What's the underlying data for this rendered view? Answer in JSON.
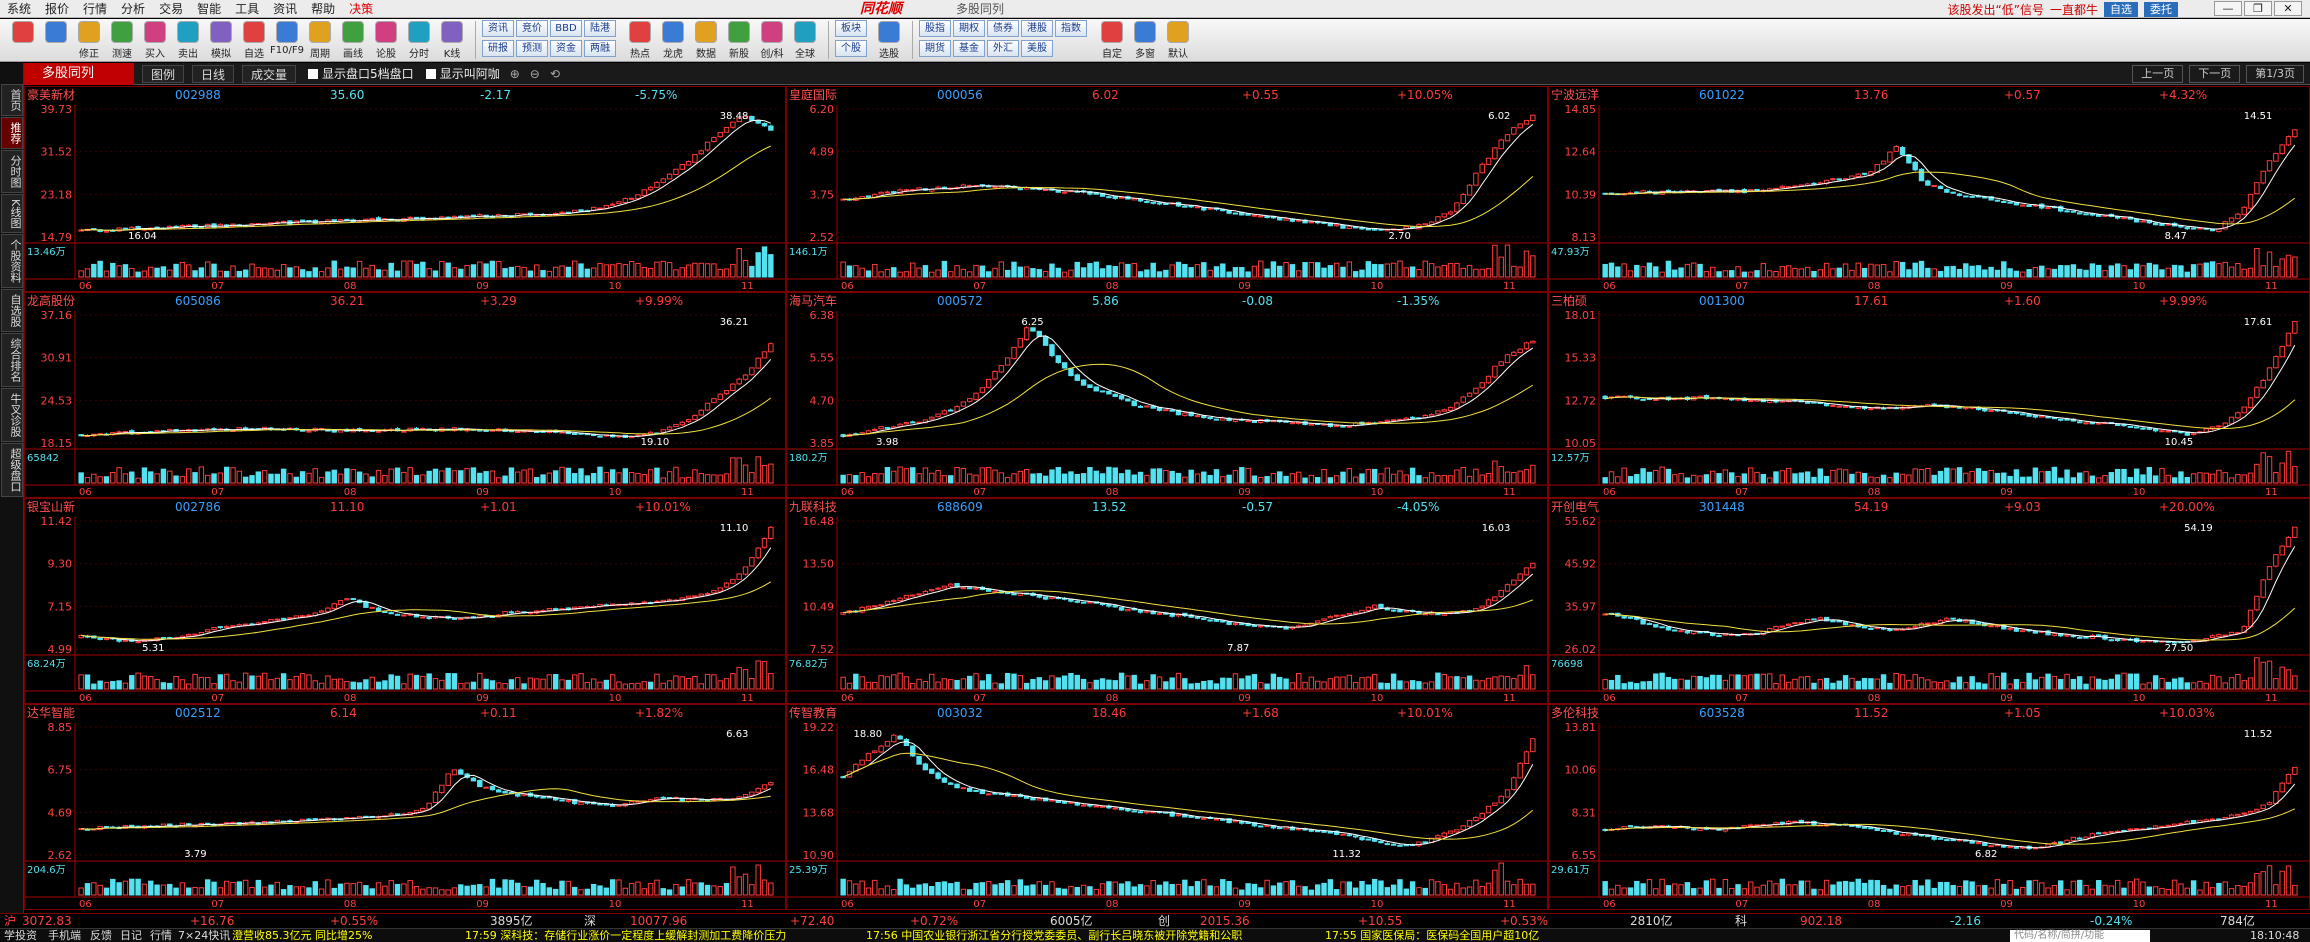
{
  "menu": {
    "items": [
      "系统",
      "报价",
      "行情",
      "分析",
      "交易",
      "智能",
      "工具",
      "资讯",
      "帮助",
      "决策"
    ],
    "logo": "同花顺",
    "window_title": "多股同列",
    "right_hint": "该股发出“低”信号",
    "right_hint2": "一直都牛",
    "btn_login": "自选",
    "btn_trade": "委托",
    "win_controls": [
      "—",
      "❐",
      "✕"
    ]
  },
  "toolbar": {
    "buttons": [
      {
        "label": "",
        "icon": "window-icon"
      },
      {
        "label": "",
        "icon": "back-icon"
      },
      {
        "label": "修正",
        "icon": "face-icon"
      },
      {
        "label": "测速",
        "icon": "clock-icon"
      },
      {
        "label": "买入",
        "icon": "buy-icon"
      },
      {
        "label": "卖出",
        "icon": "sell-icon"
      },
      {
        "label": "模拟",
        "icon": "hammer-icon"
      },
      {
        "label": "自选",
        "icon": "star-list-icon"
      },
      {
        "label": "F10/F9",
        "icon": "f10-icon"
      },
      {
        "label": "周期",
        "icon": "cycle-icon"
      },
      {
        "label": "画线",
        "icon": "pen-icon"
      },
      {
        "label": "论股",
        "icon": "discuss-icon"
      },
      {
        "label": "分时",
        "icon": "timeline-icon"
      },
      {
        "label": "K线",
        "icon": "kline-icon"
      }
    ],
    "grid_buttons": [
      "资讯",
      "竞价",
      "BBD",
      "陆港",
      "研报",
      "预测",
      "资金",
      "两融"
    ],
    "buttons2": [
      {
        "label": "热点",
        "icon": "fire-icon"
      },
      {
        "label": "龙虎",
        "icon": "dragon-icon"
      },
      {
        "label": "数据",
        "icon": "data-icon"
      },
      {
        "label": "新股",
        "icon": "newstock-icon"
      },
      {
        "label": "创/科",
        "icon": "innov-icon"
      },
      {
        "label": "全球",
        "icon": "globe-icon"
      }
    ],
    "grid_buttons2": [
      "板块",
      "个股"
    ],
    "select_label": "选股",
    "grid_buttons3": [
      "股指",
      "期权",
      "债券",
      "港股",
      "指数",
      "期货",
      "基金",
      "外汇",
      "美股"
    ],
    "buttons3": [
      {
        "label": "自定",
        "icon": "custom-icon"
      },
      {
        "label": "多窗",
        "icon": "multiwin-icon"
      },
      {
        "label": "默认",
        "icon": "home-icon"
      }
    ]
  },
  "subbar": {
    "title": "多股同列",
    "layout": "图例",
    "period": "日线",
    "indicator": "成交量",
    "opt1": "显示盘口5档盘口",
    "opt2": "显示叫阿咖",
    "prev": "上一页",
    "next": "下一页",
    "page": "第1/3页"
  },
  "sidetabs": [
    "首页",
    "推荐",
    "分时图",
    "K线图",
    "个股资料",
    "自选股",
    "综合排名",
    "牛叉诊股",
    "超级盘口"
  ],
  "theme": {
    "up": "#ff3a3a",
    "down": "#54e1f0",
    "name": "#ff5050",
    "code": "#3aa0ff",
    "axis": "#aa0000",
    "ma1": "#ffffff",
    "ma2": "#f0e040"
  },
  "panes": [
    {
      "name": "豪美新材",
      "code": "002988",
      "price": "35.60",
      "change": "-2.17",
      "pct": "-5.75%",
      "dir": "down",
      "yticks": [
        "39.73",
        "31.52",
        "23.18",
        "14.79"
      ],
      "ylo": 14.79,
      "yhi": 39.73,
      "vol": "13.46万",
      "xlabels": [
        "06",
        "07",
        "08",
        "09",
        "10",
        "11"
      ],
      "hi_label": "38.48",
      "lo_label": "16.04",
      "hi_at": 0.965,
      "lo_at": 0.07,
      "series": [
        16.0,
        16.2,
        16.4,
        16.6,
        16.8,
        17.0,
        17.2,
        17.4,
        17.6,
        17.8,
        18.0,
        18.1,
        18.3,
        18.5,
        18.7,
        18.9,
        19.0,
        19.2,
        19.5,
        20,
        21,
        23,
        26,
        30,
        35,
        38.48,
        35.6
      ]
    },
    {
      "name": "皇庭国际",
      "code": "000056",
      "price": "6.02",
      "change": "+0.55",
      "pct": "+10.05%",
      "dir": "up",
      "yticks": [
        "6.20",
        "4.89",
        "3.75",
        "2.52"
      ],
      "ylo": 2.52,
      "yhi": 6.2,
      "vol": "146.1万",
      "xlabels": [
        "06",
        "07",
        "08",
        "09",
        "10",
        "11"
      ],
      "hi_label": "6.02",
      "lo_label": "2.70",
      "hi_at": 0.965,
      "lo_at": 0.78,
      "series": [
        3.6,
        3.7,
        3.85,
        3.9,
        3.95,
        4.0,
        3.95,
        3.9,
        3.85,
        3.8,
        3.7,
        3.6,
        3.5,
        3.4,
        3.3,
        3.2,
        3.1,
        3.0,
        2.9,
        2.8,
        2.7,
        2.75,
        2.9,
        3.3,
        4.5,
        5.47,
        6.02
      ]
    },
    {
      "name": "宁波远洋",
      "code": "601022",
      "price": "13.76",
      "change": "+0.57",
      "pct": "+4.32%",
      "dir": "up",
      "yticks": [
        "14.85",
        "12.64",
        "10.39",
        "8.13"
      ],
      "ylo": 8.13,
      "yhi": 14.85,
      "vol": "47.93万",
      "xlabels": [
        "06",
        "07",
        "08",
        "09",
        "10",
        "11"
      ],
      "hi_label": "14.51",
      "lo_label": "8.47",
      "hi_at": 0.965,
      "lo_at": 0.8,
      "series": [
        10.4,
        10.5,
        10.45,
        10.5,
        10.6,
        10.5,
        10.6,
        10.8,
        11.0,
        11.2,
        11.5,
        12.9,
        11.0,
        10.4,
        10.2,
        10.0,
        9.8,
        9.6,
        9.4,
        9.2,
        9.0,
        8.8,
        8.6,
        8.5,
        9.5,
        12.0,
        13.76
      ]
    },
    {
      "name": "龙高股份",
      "code": "605086",
      "price": "36.21",
      "change": "+3.29",
      "pct": "+9.99%",
      "dir": "up",
      "yticks": [
        "37.16",
        "30.91",
        "24.53",
        "18.15"
      ],
      "ylo": 18.15,
      "yhi": 37.16,
      "vol": "65842",
      "xlabels": [
        "06",
        "07",
        "08",
        "09",
        "10",
        "11"
      ],
      "hi_label": "36.21",
      "lo_label": "19.10",
      "hi_at": 0.965,
      "lo_at": 0.8,
      "series": [
        19.3,
        19.5,
        19.7,
        19.9,
        20.0,
        20.1,
        20.2,
        20.3,
        20.2,
        20.1,
        20.0,
        20.0,
        20.1,
        20.2,
        20.2,
        20.1,
        20.0,
        19.9,
        19.8,
        19.5,
        19.2,
        19.1,
        20,
        22,
        25,
        28,
        32.9
      ]
    },
    {
      "name": "海马汽车",
      "code": "000572",
      "price": "5.86",
      "change": "-0.08",
      "pct": "-1.35%",
      "dir": "down",
      "yticks": [
        "6.38",
        "5.55",
        "4.70",
        "3.85"
      ],
      "ylo": 3.85,
      "yhi": 6.38,
      "vol": "180.2万",
      "xlabels": [
        "06",
        "07",
        "08",
        "09",
        "10",
        "11"
      ],
      "hi_label": "6.25",
      "lo_label": "3.98",
      "hi_at": 0.3,
      "lo_at": 0.05,
      "series": [
        4.0,
        4.1,
        4.2,
        4.3,
        4.5,
        4.8,
        5.4,
        6.2,
        5.5,
        5.0,
        4.8,
        4.6,
        4.5,
        4.4,
        4.35,
        4.3,
        4.3,
        4.25,
        4.2,
        4.2,
        4.25,
        4.3,
        4.4,
        4.6,
        5.0,
        5.6,
        5.86
      ]
    },
    {
      "name": "三柏硕",
      "code": "001300",
      "price": "17.61",
      "change": "+1.60",
      "pct": "+9.99%",
      "dir": "up",
      "yticks": [
        "18.01",
        "15.33",
        "12.72",
        "10.05"
      ],
      "ylo": 10.05,
      "yhi": 18.01,
      "vol": "12.57万",
      "xlabels": [
        "06",
        "07",
        "08",
        "09",
        "10",
        "11"
      ],
      "hi_label": "17.61",
      "lo_label": "10.45",
      "hi_at": 0.965,
      "lo_at": 0.8,
      "series": [
        12.9,
        12.9,
        12.8,
        12.85,
        12.9,
        12.8,
        12.7,
        12.6,
        12.5,
        12.4,
        12.2,
        12.3,
        12.4,
        12.3,
        12.2,
        12.0,
        11.8,
        11.6,
        11.4,
        11.2,
        11.0,
        10.8,
        10.6,
        11.0,
        12.0,
        14.5,
        17.61
      ]
    },
    {
      "name": "银宝山新",
      "code": "002786",
      "price": "11.10",
      "change": "+1.01",
      "pct": "+10.01%",
      "dir": "up",
      "yticks": [
        "11.42",
        "9.30",
        "7.15",
        "4.99"
      ],
      "ylo": 4.99,
      "yhi": 11.42,
      "vol": "68.24万",
      "xlabels": [
        "06",
        "07",
        "08",
        "09",
        "10",
        "11"
      ],
      "hi_label": "11.10",
      "lo_label": "5.31",
      "hi_at": 0.965,
      "lo_at": 0.09,
      "series": [
        5.6,
        5.5,
        5.4,
        5.5,
        5.7,
        6.0,
        6.2,
        6.4,
        6.6,
        6.8,
        7.6,
        7.0,
        6.7,
        6.6,
        6.5,
        6.6,
        6.8,
        6.9,
        7.0,
        7.1,
        7.2,
        7.3,
        7.4,
        7.6,
        8.0,
        9.0,
        11.1
      ]
    },
    {
      "name": "九联科技",
      "code": "688609",
      "price": "13.52",
      "change": "-0.57",
      "pct": "-4.05%",
      "dir": "down",
      "yticks": [
        "16.48",
        "13.50",
        "10.49",
        "7.52"
      ],
      "ylo": 7.52,
      "yhi": 16.48,
      "vol": "76.82万",
      "xlabels": [
        "06",
        "07",
        "08",
        "09",
        "10",
        "11"
      ],
      "hi_label": "16.03",
      "lo_label": "7.87",
      "hi_at": 0.965,
      "lo_at": 0.55,
      "series": [
        10.0,
        10.5,
        11.0,
        11.5,
        12.0,
        11.8,
        11.5,
        11.3,
        11.0,
        10.8,
        10.5,
        10.2,
        10.0,
        9.8,
        9.5,
        9.2,
        9.0,
        9.0,
        9.5,
        10.0,
        10.5,
        10.2,
        10.0,
        10.0,
        10.3,
        12.0,
        13.52
      ]
    },
    {
      "name": "开创电气",
      "code": "301448",
      "price": "54.19",
      "change": "+9.03",
      "pct": "+20.00%",
      "dir": "up",
      "yticks": [
        "55.62",
        "45.92",
        "35.97",
        "26.02"
      ],
      "ylo": 26.02,
      "yhi": 55.62,
      "vol": "76698",
      "xlabels": [
        "06",
        "07",
        "08",
        "09",
        "10",
        "11"
      ],
      "hi_label": "54.19",
      "lo_label": "27.50",
      "hi_at": 0.88,
      "lo_at": 0.8,
      "series": [
        34,
        33,
        31,
        30,
        29.5,
        29,
        30,
        32,
        33,
        32,
        31,
        30.5,
        32,
        33,
        32,
        31,
        30,
        29.5,
        29,
        28.5,
        28,
        27.5,
        28,
        29,
        30,
        45,
        54.19
      ]
    },
    {
      "name": "达华智能",
      "code": "002512",
      "price": "6.14",
      "change": "+0.11",
      "pct": "+1.82%",
      "dir": "up",
      "yticks": [
        "8.85",
        "6.75",
        "4.69",
        "2.62"
      ],
      "ylo": 2.62,
      "yhi": 8.85,
      "vol": "204.6万",
      "xlabels": [
        "06",
        "07",
        "08",
        "09",
        "10",
        "11"
      ],
      "hi_label": "6.63",
      "lo_label": "3.79",
      "hi_at": 0.965,
      "lo_at": 0.15,
      "series": [
        3.9,
        3.95,
        4.0,
        4.05,
        4.1,
        4.1,
        4.15,
        4.2,
        4.3,
        4.35,
        4.4,
        4.5,
        4.6,
        5.0,
        6.8,
        6.0,
        5.6,
        5.5,
        5.3,
        5.1,
        5.0,
        5.2,
        5.4,
        5.3,
        5.3,
        5.5,
        6.14
      ]
    },
    {
      "name": "传智教育",
      "code": "003032",
      "price": "18.46",
      "change": "+1.68",
      "pct": "+10.01%",
      "dir": "up",
      "yticks": [
        "19.22",
        "16.48",
        "13.68",
        "10.90"
      ],
      "ylo": 10.9,
      "yhi": 19.22,
      "vol": "25.39万",
      "xlabels": [
        "06",
        "07",
        "08",
        "09",
        "10",
        "11"
      ],
      "hi_label": "18.80",
      "lo_label": "11.32",
      "hi_at": 0.07,
      "lo_at": 0.7,
      "series": [
        16,
        17.5,
        18.8,
        16.5,
        15.5,
        15.0,
        14.8,
        14.6,
        14.4,
        14.2,
        14.0,
        13.8,
        13.6,
        13.4,
        13.2,
        13.0,
        12.8,
        12.6,
        12.4,
        12.2,
        11.8,
        11.5,
        11.8,
        12.5,
        13.5,
        15.0,
        18.46
      ]
    },
    {
      "name": "多伦科技",
      "code": "603528",
      "price": "11.52",
      "change": "+1.05",
      "pct": "+10.03%",
      "dir": "up",
      "yticks": [
        "13.81",
        "10.06",
        "8.31",
        "6.55"
      ],
      "ylo": 6.55,
      "yhi": 13.81,
      "vol": "29.61万",
      "xlabels": [
        "06",
        "07",
        "08",
        "09",
        "10",
        "11"
      ],
      "hi_label": "11.52",
      "lo_label": "6.82",
      "hi_at": 0.965,
      "lo_at": 0.53,
      "series": [
        8.0,
        8.1,
        8.2,
        8.1,
        8.0,
        8.1,
        8.3,
        8.4,
        8.3,
        8.2,
        8.0,
        7.8,
        7.6,
        7.4,
        7.2,
        7.0,
        6.9,
        7.2,
        7.6,
        7.9,
        8.0,
        8.2,
        8.4,
        8.6,
        8.8,
        9.5,
        11.52
      ]
    }
  ],
  "status": {
    "sh_label": "沪",
    "sh_val": "3072.83",
    "sh_chg": "+16.76",
    "sh_pct": "+0.55%",
    "sh_amt": "3895亿",
    "sz_label": "深",
    "sz_val": "10077.96",
    "sz_chg": "+72.40",
    "sz_pct": "+0.72%",
    "sz_amt": "6005亿",
    "cy_label": "创",
    "cy_val": "2015.36",
    "cy_chg": "+10.55",
    "cy_pct": "+0.53%",
    "cy_amt": "2810亿",
    "kc_label": "科",
    "kc_val": "902.18",
    "kc_chg": "-2.16",
    "kc_pct": "-0.24%",
    "kc_amt": "784亿"
  },
  "ticker": {
    "tabs": [
      "学投资",
      "手机端",
      "反馈",
      "日记",
      "行情",
      "7×24快讯"
    ],
    "items": [
      "澄营收85.3亿元 同比增25%",
      "17:59 深科技：存储行业涨价一定程度上缓解封测加工费降价压力",
      "17:56 中国农业银行浙江省分行授党委委员、副行长吕晓东被开除党籍和公职",
      "17:55 国家医保局：医保码全国用户超10亿"
    ],
    "search_placeholder": "代码/名称/简拼/功能",
    "time": "18:10:48"
  }
}
